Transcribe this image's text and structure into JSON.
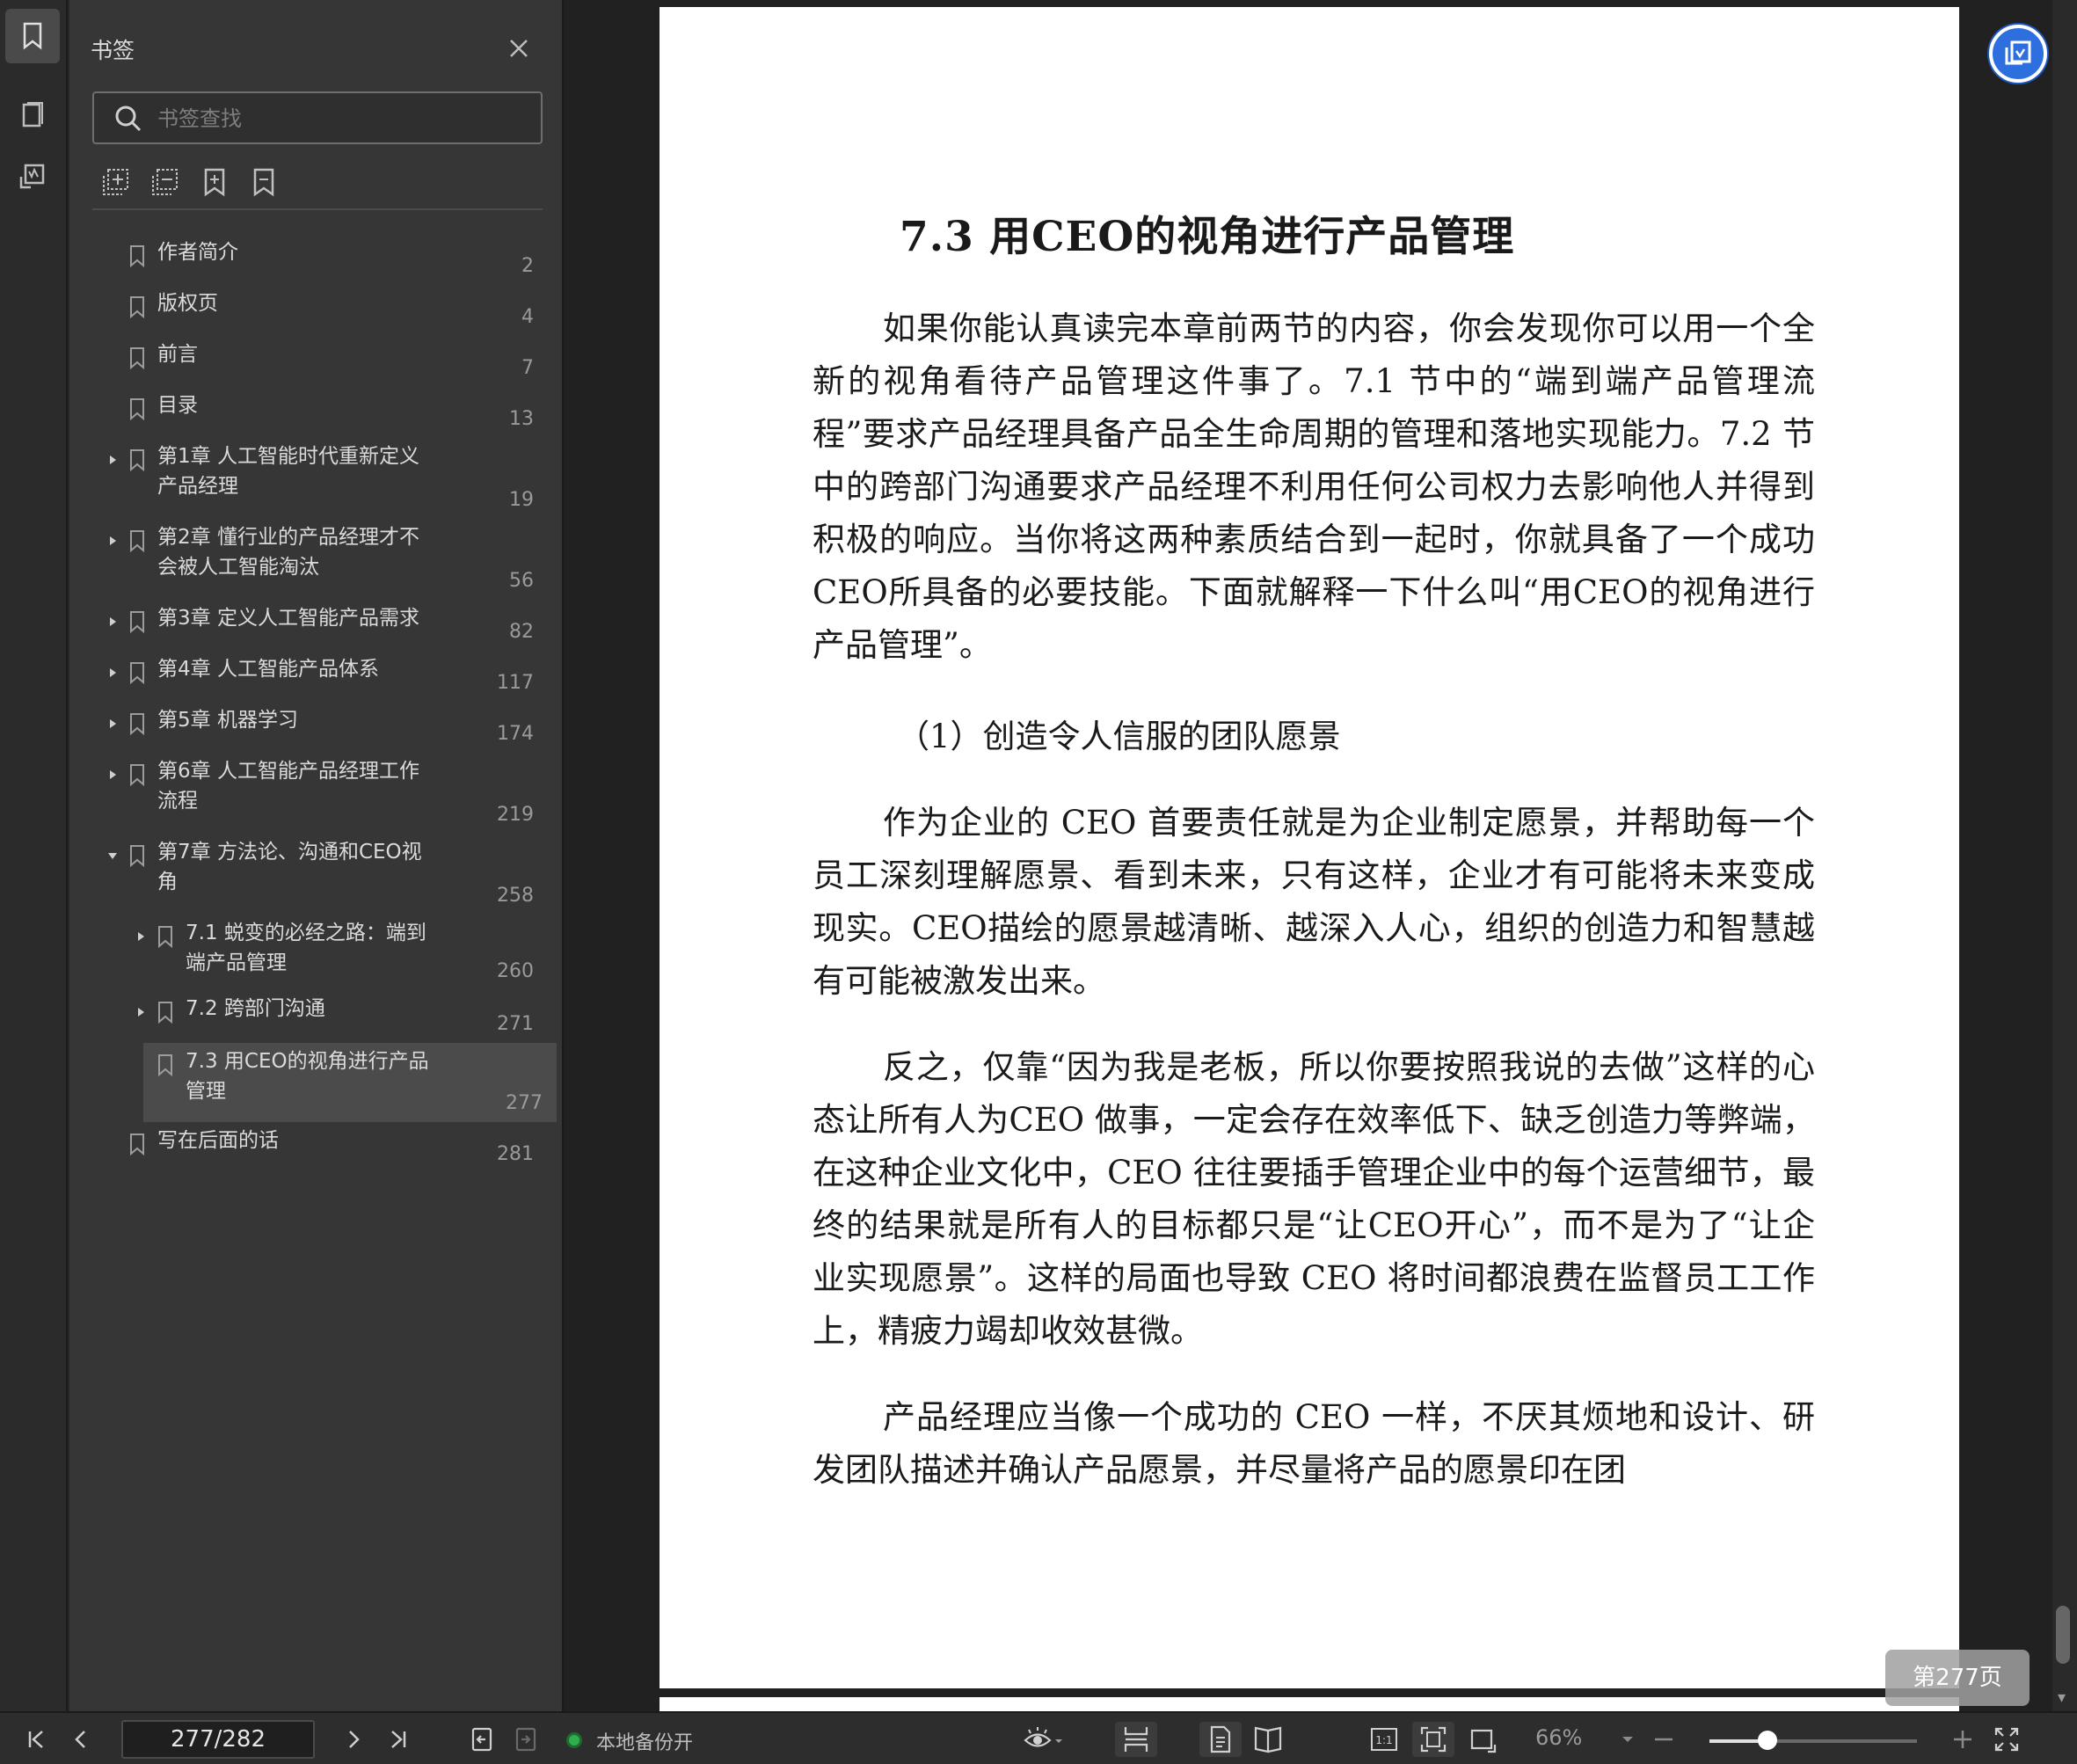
{
  "panel": {
    "title": "书签",
    "search_placeholder": "书签查找"
  },
  "bookmarks": [
    {
      "label": "作者简介",
      "page": "2",
      "level": 0,
      "expander": "none"
    },
    {
      "label": "版权页",
      "page": "4",
      "level": 0,
      "expander": "none"
    },
    {
      "label": "前言",
      "page": "7",
      "level": 0,
      "expander": "none"
    },
    {
      "label": "目录",
      "page": "13",
      "level": 0,
      "expander": "none"
    },
    {
      "label": "第1章  人工智能时代重新定义\n产品经理",
      "page": "19",
      "level": 0,
      "expander": "collapsed"
    },
    {
      "label": "第2章  懂行业的产品经理才不\n会被人工智能淘汰",
      "page": "56",
      "level": 0,
      "expander": "collapsed"
    },
    {
      "label": "第3章  定义人工智能产品需求",
      "page": "82",
      "level": 0,
      "expander": "collapsed"
    },
    {
      "label": "第4章  人工智能产品体系",
      "page": "117",
      "level": 0,
      "expander": "collapsed"
    },
    {
      "label": "第5章  机器学习",
      "page": "174",
      "level": 0,
      "expander": "collapsed"
    },
    {
      "label": "第6章  人工智能产品经理工作\n流程",
      "page": "219",
      "level": 0,
      "expander": "collapsed"
    },
    {
      "label": "第7章  方法论、沟通和CEO视\n角",
      "page": "258",
      "level": 0,
      "expander": "expanded"
    },
    {
      "label": "7.1  蜕变的必经之路：端到\n端产品管理",
      "page": "260",
      "level": 1,
      "expander": "collapsed"
    },
    {
      "label": "7.2  跨部门沟通",
      "page": "271",
      "level": 1,
      "expander": "collapsed"
    },
    {
      "label": "7.3  用CEO的视角进行产品\n管理",
      "page": "277",
      "level": 1,
      "expander": "none",
      "selected": true
    },
    {
      "label": "写在后面的话",
      "page": "281",
      "level": 0,
      "expander": "none"
    }
  ],
  "document": {
    "heading": "7.3 用CEO的视角进行产品管理",
    "paragraph1": "如果你能认真读完本章前两节的内容，你会发现你可以用一个全新的视角看待产品管理这件事了。7.1 节中的“端到端产品管理流程”要求产品经理具备产品全生命周期的管理和落地实现能力。7.2  节中的跨部门沟通要求产品经理不利用任何公司权力去影响他人并得到积极的响应。当你将这两种素质结合到一起时，你就具备了一个成功CEO所具备的必要技能。下面就解释一下什么叫“用CEO的视角进行产品管理”。",
    "subheading": "（1）创造令人信服的团队愿景",
    "paragraph2": "作为企业的  CEO  首要责任就是为企业制定愿景，并帮助每一个员工深刻理解愿景、看到未来，只有这样，企业才有可能将未来变成现实。CEO描绘的愿景越清晰、越深入人心，组织的创造力和智慧越有可能被激发出来。",
    "paragraph3": "反之，仅靠“因为我是老板，所以你要按照我说的去做”这样的心态让所有人为CEO 做事，一定会存在效率低下、缺乏创造力等弊端，在这种企业文化中，CEO 往往要插手管理企业中的每个运营细节，最终的结果就是所有人的目标都只是“让CEO开心”，而不是为了“让企业实现愿景”。这样的局面也导致  CEO  将时间都浪费在监督员工工作上，精疲力竭却收效甚微。",
    "paragraph4": "产品经理应当像一个成功的   CEO   一样，不厌其烦地和设计、研发团队描述并确认产品愿景，并尽量将产品的愿景印在团"
  },
  "page_badge": "第277页",
  "status": {
    "page_field": "277/282",
    "backup_label": "本地备份开",
    "zoom_label": "66%",
    "zoom_fraction": 0.28
  },
  "colors": {
    "accent_blue": "#2e6fe0",
    "backup_green": "#2fae4e"
  },
  "icons": [
    "bookmark-icon",
    "thumbnail-icon",
    "annotation-icon",
    "search-icon",
    "close-icon",
    "first-page-icon",
    "prev-page-icon",
    "next-page-icon",
    "last-page-icon",
    "eye-icon",
    "zoom-in-icon",
    "zoom-out-icon",
    "fullscreen-icon"
  ]
}
